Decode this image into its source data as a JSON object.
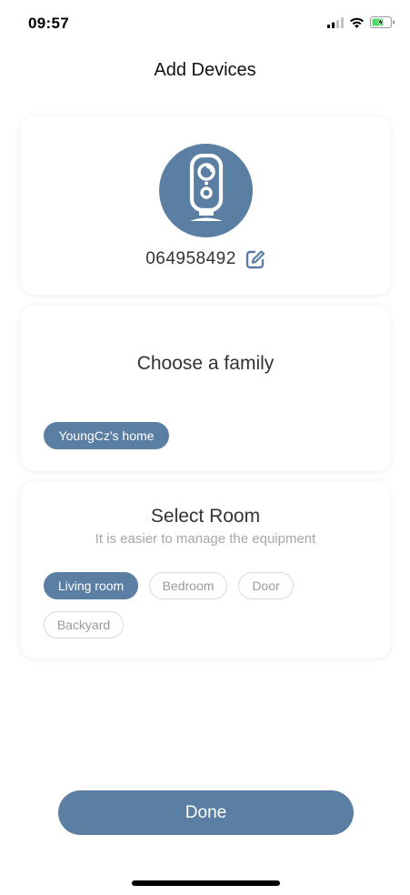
{
  "status_bar": {
    "time": "09:57",
    "icons": [
      "cellular-signal-icon",
      "wifi-icon",
      "battery-charging-icon"
    ]
  },
  "nav": {
    "title": "Add Devices"
  },
  "device": {
    "icon": "camera-icon",
    "id": "064958492",
    "edit_icon": "edit-icon",
    "accent_color": "#5b7ea3"
  },
  "family": {
    "title": "Choose a family",
    "options": [
      {
        "label": "YoungCz's home",
        "selected": true
      }
    ]
  },
  "room": {
    "title": "Select Room",
    "subtitle": "It is easier to manage the equipment",
    "options": [
      {
        "label": "Living room",
        "selected": true
      },
      {
        "label": "Bedroom",
        "selected": false
      },
      {
        "label": "Door",
        "selected": false
      },
      {
        "label": "Backyard",
        "selected": false
      }
    ]
  },
  "actions": {
    "done_label": "Done"
  }
}
